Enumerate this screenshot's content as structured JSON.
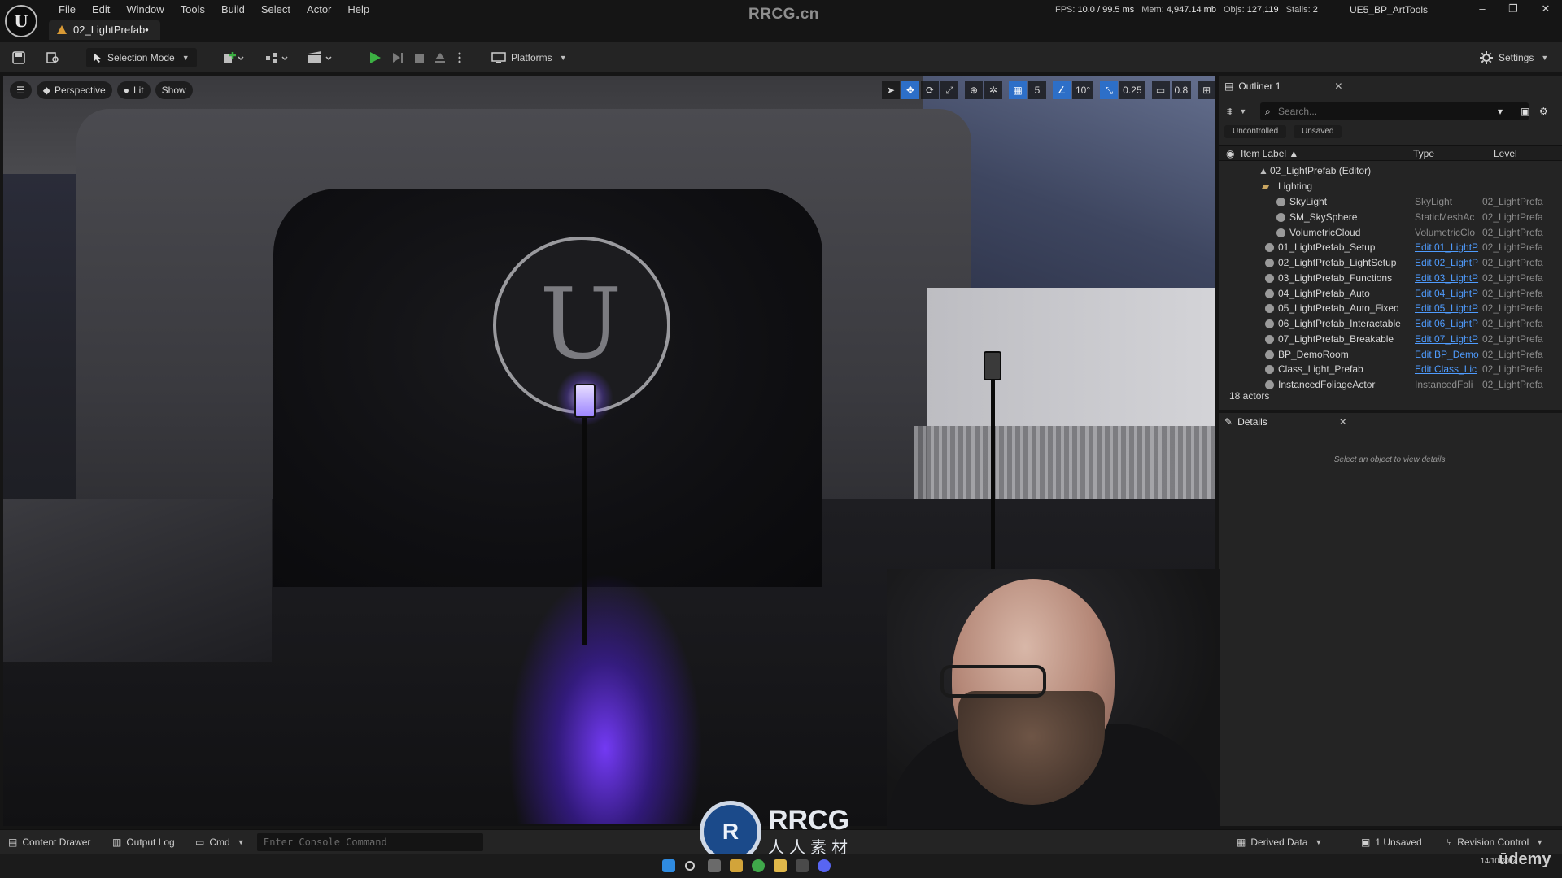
{
  "window": {
    "app_title": "RRCG.cn",
    "document_tab": "02_LightPrefab•",
    "project": "UE5_BP_ArtTools",
    "menu": [
      "File",
      "Edit",
      "Window",
      "Tools",
      "Build",
      "Select",
      "Actor",
      "Help"
    ],
    "stats": {
      "fps_label": "FPS:",
      "fps": "10.0",
      "ms": "/ 99.5 ms",
      "mem_label": "Mem:",
      "mem": "4,947.14 mb",
      "objs_label": "Objs:",
      "objs": "127,119",
      "stalls_label": "Stalls:",
      "stalls": "2"
    }
  },
  "toolbar": {
    "selection_mode": "Selection Mode",
    "platforms": "Platforms",
    "settings": "Settings"
  },
  "viewport": {
    "perspective": "Perspective",
    "lit": "Lit",
    "show": "Show",
    "grid_size": "5",
    "rotation_snap": "10°",
    "scale_snap": "0.25",
    "camera_speed": "0.8"
  },
  "outliner": {
    "tab_title": "Outliner 1",
    "search_placeholder": "Search...",
    "filters": [
      "Uncontrolled",
      "Unsaved"
    ],
    "columns": {
      "label": "Item Label ▲",
      "type": "Type",
      "level": "Level"
    },
    "root": "02_LightPrefab (Editor)",
    "folder": "Lighting",
    "rows": [
      {
        "label": "SkyLight",
        "type": "SkyLight",
        "level": "02_LightPrefa",
        "link": false
      },
      {
        "label": "SM_SkySphere",
        "type": "StaticMeshAc",
        "level": "02_LightPrefa",
        "link": false
      },
      {
        "label": "VolumetricCloud",
        "type": "VolumetricClo",
        "level": "02_LightPrefa",
        "link": false
      },
      {
        "label": "01_LightPrefab_Setup",
        "type": "Edit 01_LightP",
        "level": "02_LightPrefa",
        "link": true
      },
      {
        "label": "02_LightPrefab_LightSetup",
        "type": "Edit 02_LightP",
        "level": "02_LightPrefa",
        "link": true
      },
      {
        "label": "03_LightPrefab_Functions",
        "type": "Edit 03_LightP",
        "level": "02_LightPrefa",
        "link": true
      },
      {
        "label": "04_LightPrefab_Auto",
        "type": "Edit 04_LightP",
        "level": "02_LightPrefa",
        "link": true
      },
      {
        "label": "05_LightPrefab_Auto_Fixed",
        "type": "Edit 05_LightP",
        "level": "02_LightPrefa",
        "link": true
      },
      {
        "label": "06_LightPrefab_Interactable",
        "type": "Edit 06_LightP",
        "level": "02_LightPrefa",
        "link": true
      },
      {
        "label": "07_LightPrefab_Breakable",
        "type": "Edit 07_LightP",
        "level": "02_LightPrefa",
        "link": true
      },
      {
        "label": "BP_DemoRoom",
        "type": "Edit BP_Demo",
        "level": "02_LightPrefa",
        "link": true
      },
      {
        "label": "Class_Light_Prefab",
        "type": "Edit Class_Lic",
        "level": "02_LightPrefa",
        "link": true
      },
      {
        "label": "InstancedFoliageActor",
        "type": "InstancedFoli",
        "level": "02_LightPrefa",
        "link": false
      }
    ],
    "actor_count": "18 actors"
  },
  "details": {
    "tab_title": "Details",
    "empty_message": "Select an object to view details."
  },
  "statusbar": {
    "content_drawer": "Content Drawer",
    "output_log": "Output Log",
    "cmd": "Cmd",
    "console_placeholder": "Enter Console Command",
    "derived_data": "Derived Data",
    "unsaved": "1 Unsaved",
    "revision_control": "Revision Control"
  },
  "overlay": {
    "rrcg_badge": "R",
    "rrcg_name": "RRCG",
    "rrcg_sub": "人人素材",
    "udemy": "ūdemy",
    "tray_date": "14/10/2024"
  }
}
